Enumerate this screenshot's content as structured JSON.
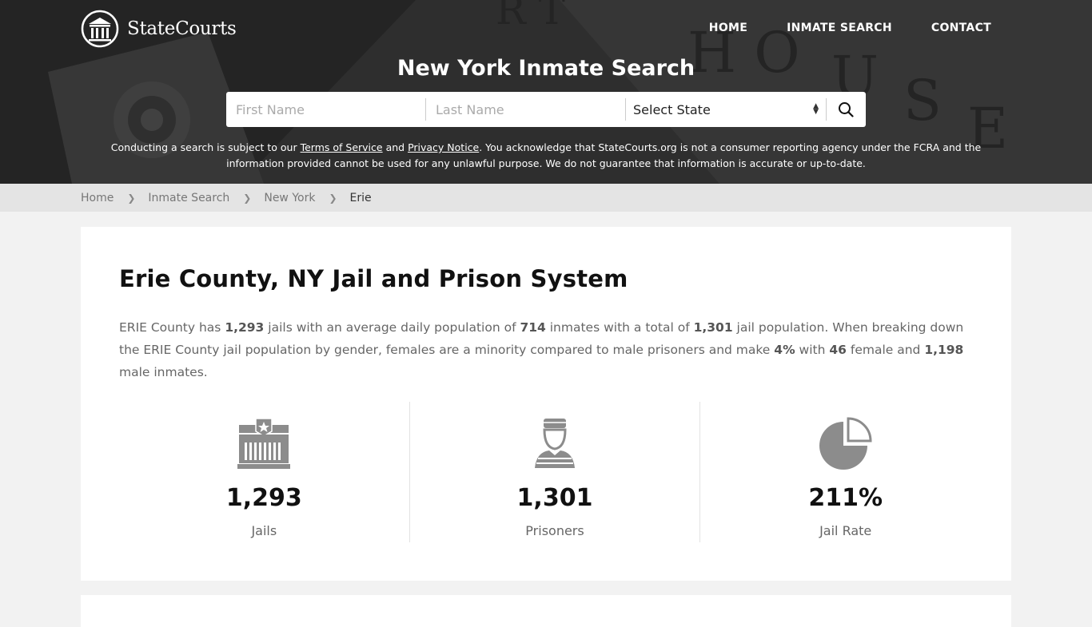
{
  "brand": {
    "name": "StateCourts"
  },
  "nav": {
    "home": "HOME",
    "inmate_search": "INMATE SEARCH",
    "contact": "CONTACT"
  },
  "hero": {
    "title": "New York Inmate Search",
    "first_name_placeholder": "First Name",
    "last_name_placeholder": "Last Name",
    "state_select": "Select State",
    "disclaimer_pre": "Conducting a search is subject to our ",
    "terms_link": "Terms of Service",
    "and": " and ",
    "privacy_link": "Privacy Notice",
    "disclaimer_post": ". You acknowledge that StateCourts.org is not a consumer reporting agency under the FCRA and the information provided cannot be used for any unlawful purpose. We do not guarantee that information is accurate or up-to-date."
  },
  "breadcrumb": {
    "home": "Home",
    "inmate_search": "Inmate Search",
    "state": "New York",
    "county": "Erie"
  },
  "main": {
    "title": "Erie County, NY Jail and Prison System",
    "intro": {
      "t1": "ERIE County has ",
      "jails": "1,293",
      "t2": " jails with an average daily population of ",
      "avg": "714",
      "t3": " inmates with a total of ",
      "total": "1,301",
      "t4": " jail population. When breaking down the ERIE County jail population by gender, females are a minority compared to male prisoners and make ",
      "pct": "4%",
      "t5": " with ",
      "female": "46",
      "t6": " female and ",
      "male": "1,198",
      "t7": " male inmates."
    },
    "stats": [
      {
        "value": "1,293",
        "label": "Jails",
        "icon": "jail-building-icon"
      },
      {
        "value": "1,301",
        "label": "Prisoners",
        "icon": "prisoner-icon"
      },
      {
        "value": "211%",
        "label": "Jail Rate",
        "icon": "pie-chart-icon"
      }
    ]
  },
  "colors": {
    "accent": "#ffffff",
    "icon_gray": "#8c8c8c",
    "breadcrumb_bg": "#e4e4e4"
  }
}
